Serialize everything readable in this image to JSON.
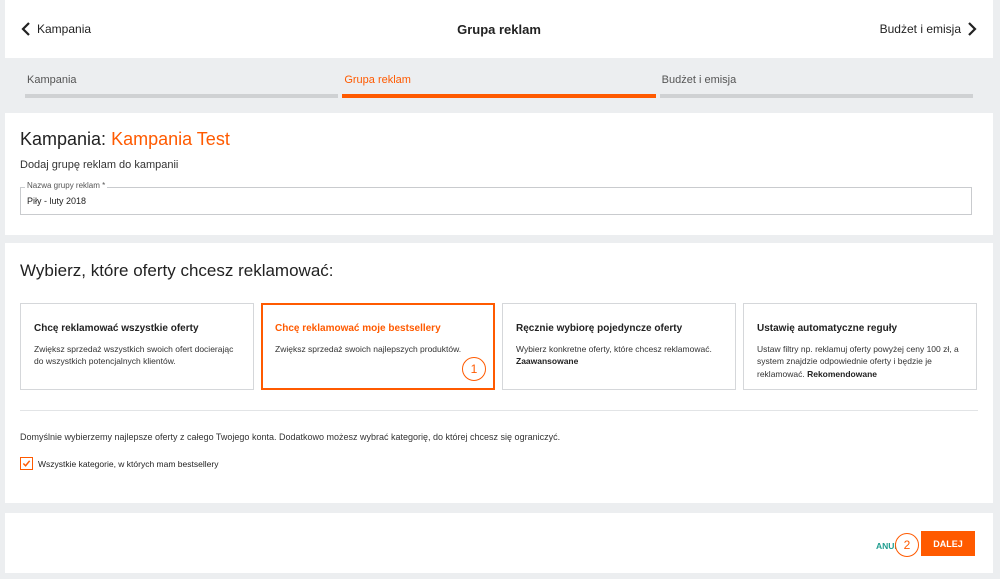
{
  "header": {
    "back_label": "Kampania",
    "title": "Grupa reklam",
    "next_label": "Budżet i emisja"
  },
  "steps": [
    {
      "label": "Kampania",
      "active": false
    },
    {
      "label": "Grupa reklam",
      "active": true
    },
    {
      "label": "Budżet i emisja",
      "active": false
    }
  ],
  "campaign": {
    "title_prefix": "Kampania:",
    "name": "Kampania Test",
    "subtitle": "Dodaj grupę reklam do kampanii",
    "field_label": "Nazwa grupy reklam *",
    "field_value": "Piły - luty 2018"
  },
  "offers": {
    "title": "Wybierz, które oferty chcesz reklamować:",
    "options": [
      {
        "title": "Chcę reklamować wszystkie oferty",
        "desc": "Zwiększ sprzedaż wszystkich swoich ofert docierając do wszystkich potencjalnych klientów.",
        "tag": ""
      },
      {
        "title": "Chcę reklamować moje bestsellery",
        "desc": "Zwiększ sprzedaż swoich najlepszych produktów.",
        "tag": ""
      },
      {
        "title": "Ręcznie wybiorę pojedyncze oferty",
        "desc": "Wybierz konkretne oferty, które chcesz reklamować.",
        "tag": "Zaawansowane"
      },
      {
        "title": "Ustawię automatyczne reguły",
        "desc": "Ustaw filtry np. reklamuj oferty powyżej ceny 100 zł, a system znajdzie odpowiednie oferty i będzie je reklamować.",
        "tag": "Rekomendowane"
      }
    ],
    "selected_index": 1,
    "hint": "Domyślnie wybierzemy najlepsze oferty z całego Twojego konta. Dodatkowo możesz wybrać kategorię, do której chcesz się ograniczyć.",
    "checkbox_label": "Wszystkie kategorie, w których mam bestsellery",
    "checkbox_checked": true
  },
  "badges": {
    "one": "1",
    "two": "2"
  },
  "footer": {
    "cancel_label": "ANULUJ",
    "next_label": "DALEJ"
  },
  "colors": {
    "accent": "#ff5a00",
    "link": "#1f9d8f"
  }
}
